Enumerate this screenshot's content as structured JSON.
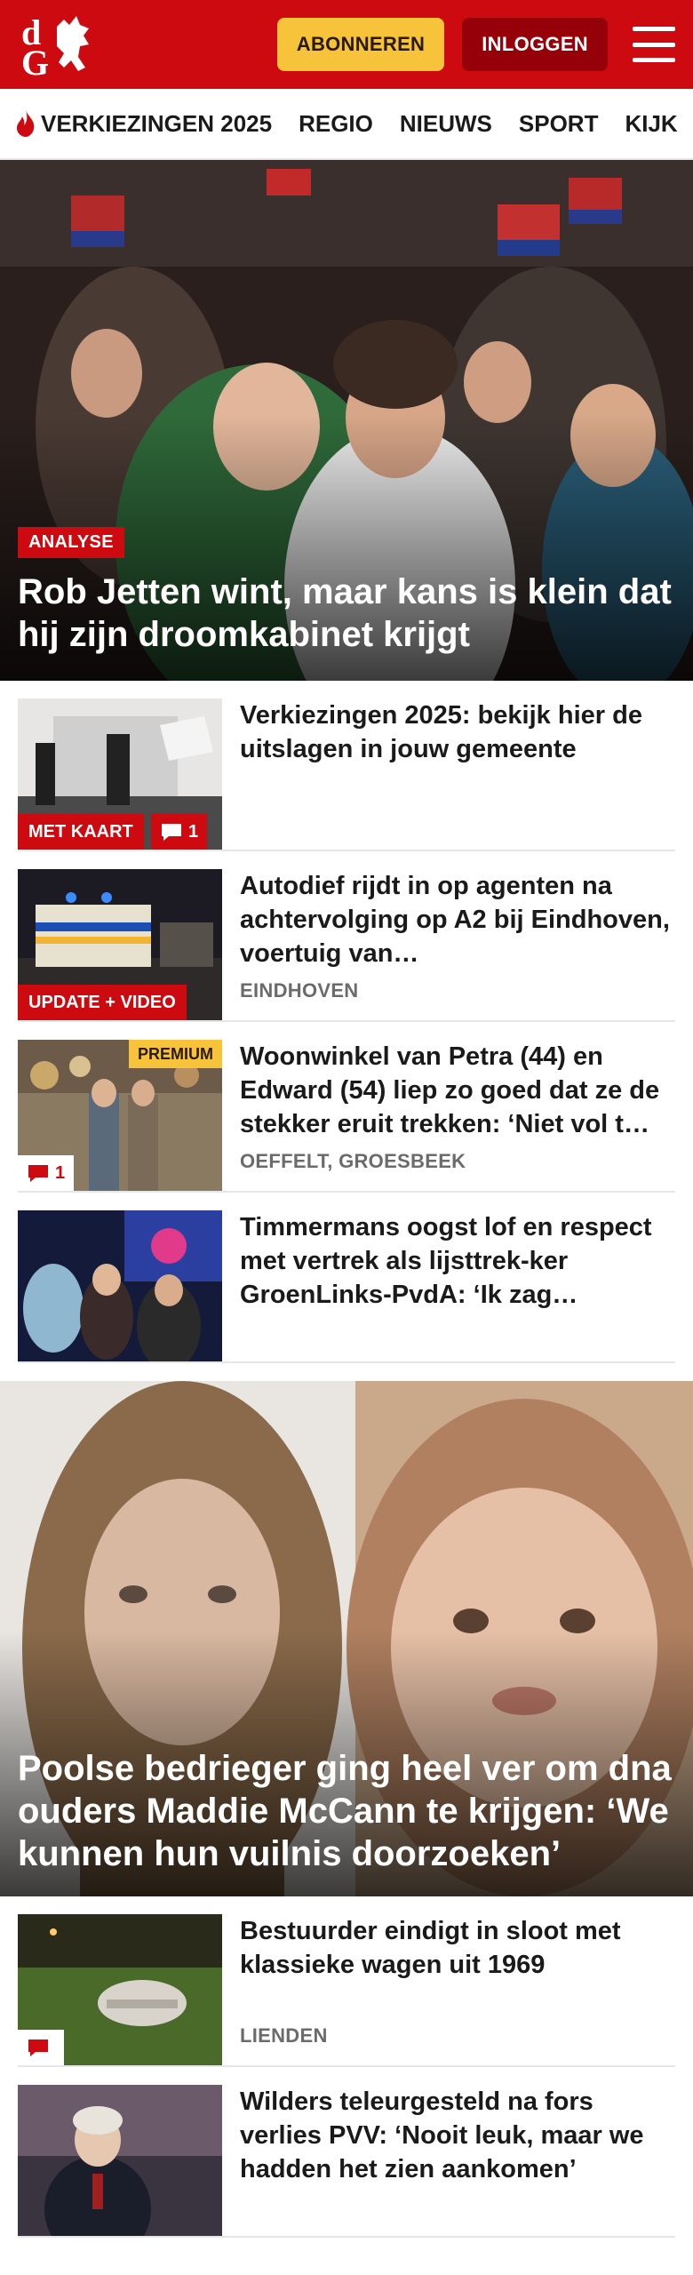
{
  "header": {
    "logo_text": "dG",
    "subscribe_label": "ABONNEREN",
    "login_label": "INLOGGEN",
    "colors": {
      "brand": "#cc0a0f",
      "subscribe": "#f6c33b",
      "login": "#960008"
    }
  },
  "nav": {
    "items": [
      {
        "label": "VERKIEZINGEN 2025",
        "icon": "flame-icon"
      },
      {
        "label": "REGIO"
      },
      {
        "label": "NIEUWS"
      },
      {
        "label": "SPORT"
      },
      {
        "label": "KIJK"
      }
    ]
  },
  "hero": {
    "label": "ANALYSE",
    "title": "Rob Jetten wint, maar kans is klein dat hij zijn droomkabinet krijgt"
  },
  "articles": [
    {
      "title": "Verkiezingen 2025: bekijk hier de uitslagen in jouw gemeente",
      "location": "",
      "badge": "MET KAART",
      "comments": "1"
    },
    {
      "title": "Autodief rijdt in op agenten na achtervolging op A2 bij Eindhoven, voertuig van…",
      "location": "EINDHOVEN",
      "badge": "UPDATE + VIDEO"
    },
    {
      "title": "Woonwinkel van Petra (44) en Edward (54) liep zo goed dat ze de stekker eruit trekken: ‘Niet vol t…",
      "location": "OEFFELT, GROESBEEK",
      "premium": "PREMIUM",
      "comments": "1"
    },
    {
      "title": "Timmermans oogst lof en respect met vertrek als lijsttrek-ker GroenLinks-PvdA: ‘Ik zag…",
      "location": ""
    }
  ],
  "feature": {
    "title": "Poolse bedrieger ging heel ver om dna ouders Maddie McCann te krijgen: ‘We kunnen hun vuilnis doorzoeken’"
  },
  "articles2": [
    {
      "title": "Bestuurder eindigt in sloot met klassieke wagen uit 1969",
      "location": "LIENDEN"
    },
    {
      "title": "Wilders teleurgesteld na fors verlies PVV: ‘Nooit leuk, maar we hadden het zien aankomen’",
      "location": ""
    }
  ]
}
